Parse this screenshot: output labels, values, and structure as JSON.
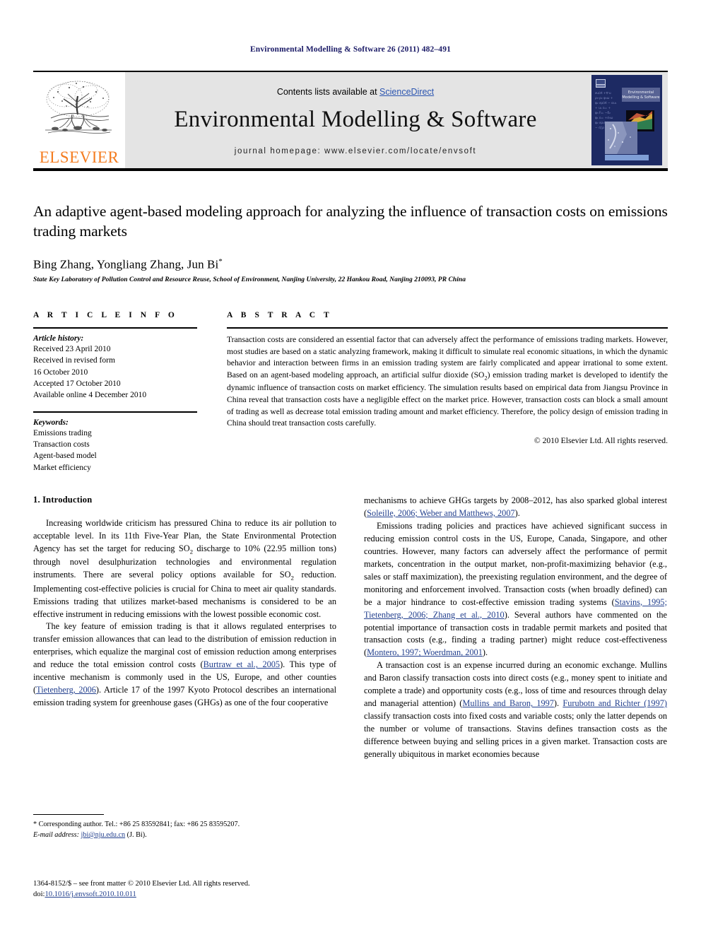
{
  "running_head": "Environmental Modelling & Software 26 (2011) 482–491",
  "masthead": {
    "publisher": "ELSEVIER",
    "contents_prefix": "Contents lists available at ",
    "contents_link": "ScienceDirect",
    "journal_title": "Environmental Modelling & Software",
    "homepage": "journal homepage: www.elsevier.com/locate/envsoft",
    "cover_title": "Environmental Modelling & Software",
    "accent_orange": "#F47C20",
    "link_blue": "#2b55b0",
    "cover_navy": "#1d2a63"
  },
  "article": {
    "title": "An adaptive agent-based modeling approach for analyzing the influence of transaction costs on emissions trading markets",
    "authors": "Bing Zhang, Yongliang Zhang, Jun Bi",
    "author_marker": "*",
    "affiliation": "State Key Laboratory of Pollution Control and Resource Reuse, School of Environment, Nanjing University, 22 Hankou Road, Nanjing 210093, PR China"
  },
  "info": {
    "heading": "A R T I C L E   I N F O",
    "history_label": "Article history:",
    "history": [
      "Received 23 April 2010",
      "Received in revised form",
      "16 October 2010",
      "Accepted 17 October 2010",
      "Available online 4 December 2010"
    ],
    "keywords_label": "Keywords:",
    "keywords": [
      "Emissions trading",
      "Transaction costs",
      "Agent-based model",
      "Market efficiency"
    ]
  },
  "abstract": {
    "heading": "A B S T R A C T",
    "part1": "Transaction costs are considered an essential factor that can adversely affect the performance of emissions trading markets. However, most studies are based on a static analyzing framework, making it difficult to simulate real economic situations, in which the dynamic behavior and interaction between firms in an emission trading system are fairly complicated and appear irrational to some extent. Based on an agent-based modeling approach, an artificial sulfur dioxide (SO",
    "sub1": "2",
    "part2": ") emission trading market is developed to identify the dynamic influence of transaction costs on market efficiency. The simulation results based on empirical data from Jiangsu Province in China reveal that transaction costs have a negligible effect on the market price. However, transaction costs can block a small amount of trading as well as decrease total emission trading amount and market efficiency. Therefore, the policy design of emission trading in China should treat transaction costs carefully.",
    "copyright": "© 2010 Elsevier Ltd. All rights reserved."
  },
  "body": {
    "section_title": "1. Introduction",
    "left": {
      "p1_a": "Increasing worldwide criticism has pressured China to reduce its air pollution to acceptable level. In its 11th Five-Year Plan, the State Environmental Protection Agency has set the target for reducing SO",
      "p1_sub": "2",
      "p1_b": " discharge to 10% (22.95 million tons) through novel desulphurization technologies and environmental regulation instruments. There are several policy options available for SO",
      "p1_sub2": "2",
      "p1_c": " reduction. Implementing cost-effective policies is crucial for China to meet air quality standards. Emissions trading that utilizes market-based mechanisms is considered to be an effective instrument in reducing emissions with the lowest possible economic cost.",
      "p2_a": "The key feature of emission trading is that it allows regulated enterprises to transfer emission allowances that can lead to the distribution of emission reduction in enterprises, which equalize the marginal cost of emission reduction among enterprises and reduce the total emission control costs (",
      "p2_cite1": "Burtraw et al., 2005",
      "p2_b": "). This type of incentive mechanism is commonly used in the US, Europe, and other counties (",
      "p2_cite2": "Tietenberg, 2006",
      "p2_c": "). Article 17 of the 1997 Kyoto Protocol describes an international emission trading system for greenhouse gases (GHGs) as one of the four cooperative"
    },
    "right": {
      "p2_d": "mechanisms to achieve GHGs targets by 2008–2012, has also sparked global interest (",
      "p2_cite3": "Soleille, 2006; Weber and Matthews, 2007",
      "p2_e": ").",
      "p3_a": "Emissions trading policies and practices have achieved significant success in reducing emission control costs in the US, Europe, Canada, Singapore, and other countries. However, many factors can adversely affect the performance of permit markets, concentration in the output market, non-profit-maximizing behavior (e.g., sales or staff maximization), the preexisting regulation environment, and the degree of monitoring and enforcement involved. Transaction costs (when broadly defined) can be a major hindrance to cost-effective emission trading systems (",
      "p3_cite1": "Stavins, 1995; Tietenberg, 2006; Zhang et al., 2010",
      "p3_b": "). Several authors have commented on the potential importance of transaction costs in tradable permit markets and posited that transaction costs (e.g., finding a trading partner) might reduce cost-effectiveness (",
      "p3_cite2": "Montero, 1997; Woerdman, 2001",
      "p3_c": ").",
      "p4_a": "A transaction cost is an expense incurred during an economic exchange. Mullins and Baron classify transaction costs into direct costs (e.g., money spent to initiate and complete a trade) and opportunity costs (e.g., loss of time and resources through delay and managerial attention) (",
      "p4_cite1": "Mullins and Baron, 1997",
      "p4_b": "). ",
      "p4_cite2": "Furubotn and Richter (1997)",
      "p4_c": " classify transaction costs into fixed costs and variable costs; only the latter depends on the number or volume of transactions. Stavins defines transaction costs as the difference between buying and selling prices in a given market. Transaction costs are generally ubiquitous in market economies because"
    }
  },
  "footnote": {
    "marker": "*",
    "line1": " Corresponding author. Tel.: +86 25 83592841; fax: +86 25 83595207.",
    "email_label": "E-mail address:",
    "email": "jbi@nju.edu.cn",
    "email_suffix": " (J. Bi)."
  },
  "footer": {
    "line1": "1364-8152/$ – see front matter © 2010 Elsevier Ltd. All rights reserved.",
    "doi_prefix": "doi:",
    "doi": "10.1016/j.envsoft.2010.10.011"
  }
}
